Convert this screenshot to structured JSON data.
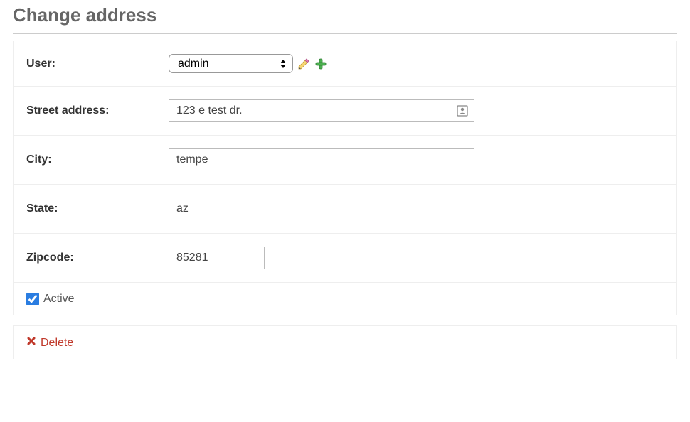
{
  "page": {
    "title": "Change address"
  },
  "form": {
    "user": {
      "label": "User:",
      "value": "admin"
    },
    "street": {
      "label": "Street address:",
      "value": "123 e test dr."
    },
    "city": {
      "label": "City:",
      "value": "tempe"
    },
    "state": {
      "label": "State:",
      "value": "az"
    },
    "zipcode": {
      "label": "Zipcode:",
      "value": "85281"
    },
    "active": {
      "label": "Active",
      "checked": true
    }
  },
  "actions": {
    "delete": "Delete"
  }
}
